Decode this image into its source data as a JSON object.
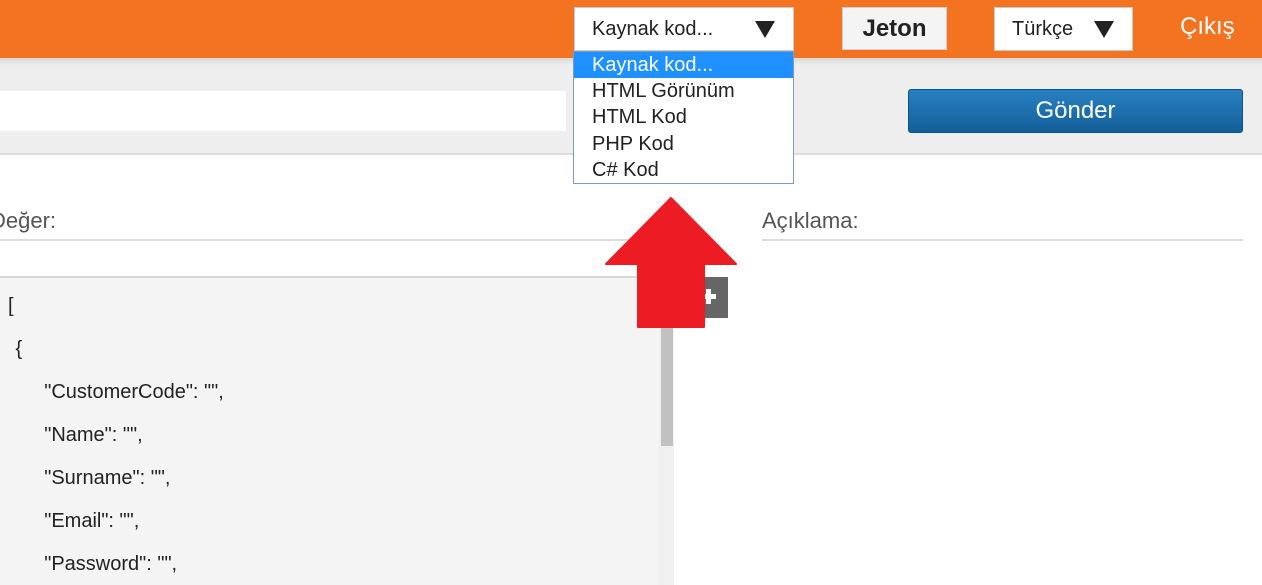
{
  "header": {
    "code_select_value": "Kaynak kod...",
    "token_label": "Jeton",
    "language_select_value": "Türkçe",
    "logout_label": "Çıkış"
  },
  "dropdown": {
    "options": [
      {
        "label": "Kaynak kod...",
        "selected": true
      },
      {
        "label": "HTML Görünüm",
        "selected": false
      },
      {
        "label": "HTML Kod",
        "selected": false
      },
      {
        "label": "PHP Kod",
        "selected": false
      },
      {
        "label": "C# Kod",
        "selected": false
      }
    ]
  },
  "request": {
    "url_value": "",
    "send_label": "Gönder"
  },
  "labels": {
    "value": "Değer:",
    "description": "Açıklama:"
  },
  "editor": {
    "lines": [
      "[",
      " {",
      "    \"CustomerCode\": \"\",",
      "    \"Name\": \"\",",
      "    \"Surname\": \"\",",
      "    \"Email\": \"\",",
      "    \"Password\": \"\","
    ]
  },
  "icons": {
    "select_caret": "triangle-down-icon",
    "expand": "plus-icon",
    "annotation": "red-up-arrow-icon"
  },
  "colors": {
    "topbar": "#f47321",
    "send_button": "#1d6fae",
    "dropdown_highlight": "#1e90ff",
    "arrow": "#ed1c24"
  }
}
